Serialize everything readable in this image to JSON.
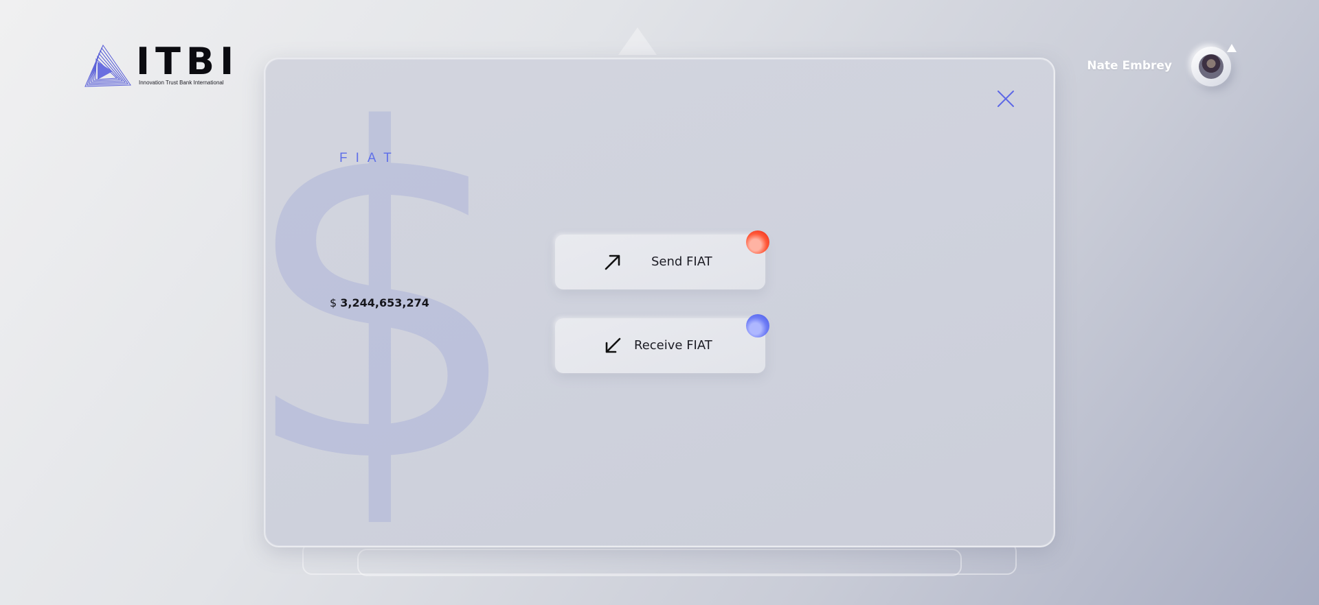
{
  "brand": {
    "name": "ITBI",
    "tagline": "Innovation Trust Bank International"
  },
  "user": {
    "name": "Nate Embrey"
  },
  "panel": {
    "title": "FIAT",
    "balance_currency": "$",
    "balance_value": "3,244,653,274",
    "background_glyph": "$"
  },
  "actions": {
    "send_label": "Send FIAT",
    "receive_label": "Receive FIAT"
  },
  "icons": {
    "close": "close-icon",
    "send": "arrow-up-right-icon",
    "receive": "arrow-down-left-icon",
    "logo": "triangle-play-logo",
    "notification": "notification-triangle-icon"
  },
  "colors": {
    "accent": "#6070e8",
    "send_indicator": "#f02a1a",
    "receive_indicator": "#4a5cec"
  }
}
